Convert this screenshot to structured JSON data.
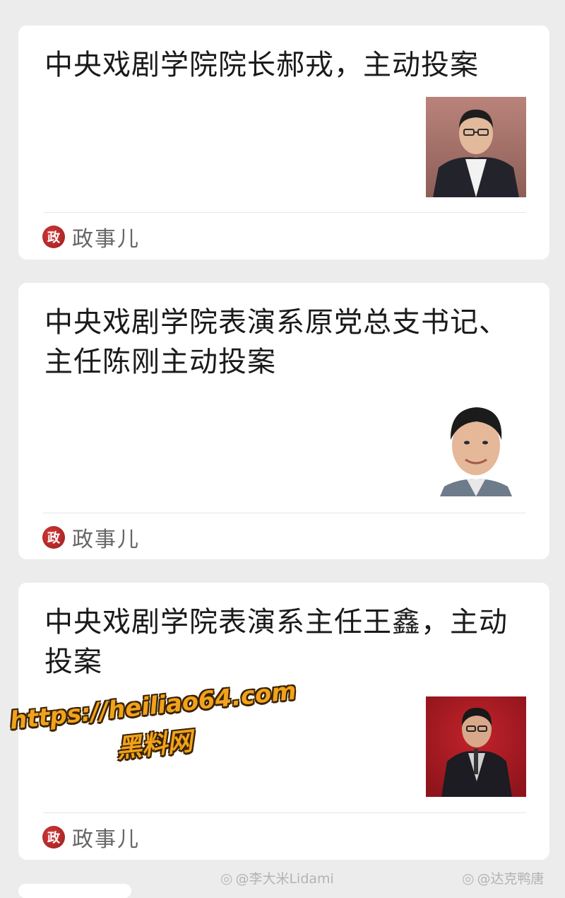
{
  "cards": [
    {
      "title": "中央戏剧学院院长郝戎，主动投案",
      "source_logo": "政",
      "source_name": "政事儿"
    },
    {
      "title": "中央戏剧学院表演系原党总支书记、主任陈刚主动投案",
      "source_logo": "政",
      "source_name": "政事儿"
    },
    {
      "title": "中央戏剧学院表演系主任王鑫，主动投案",
      "source_logo": "政",
      "source_name": "政事儿"
    }
  ],
  "watermark": {
    "url": "https://heiliao64.com",
    "name": "黑料网"
  },
  "credits": {
    "left": "@李大米Lidami",
    "right": "@达克鸭唐"
  },
  "colors": {
    "background": "#ececec",
    "card": "#ffffff",
    "logo_red": "#c62828",
    "watermark_orange": "#f1a21b"
  }
}
